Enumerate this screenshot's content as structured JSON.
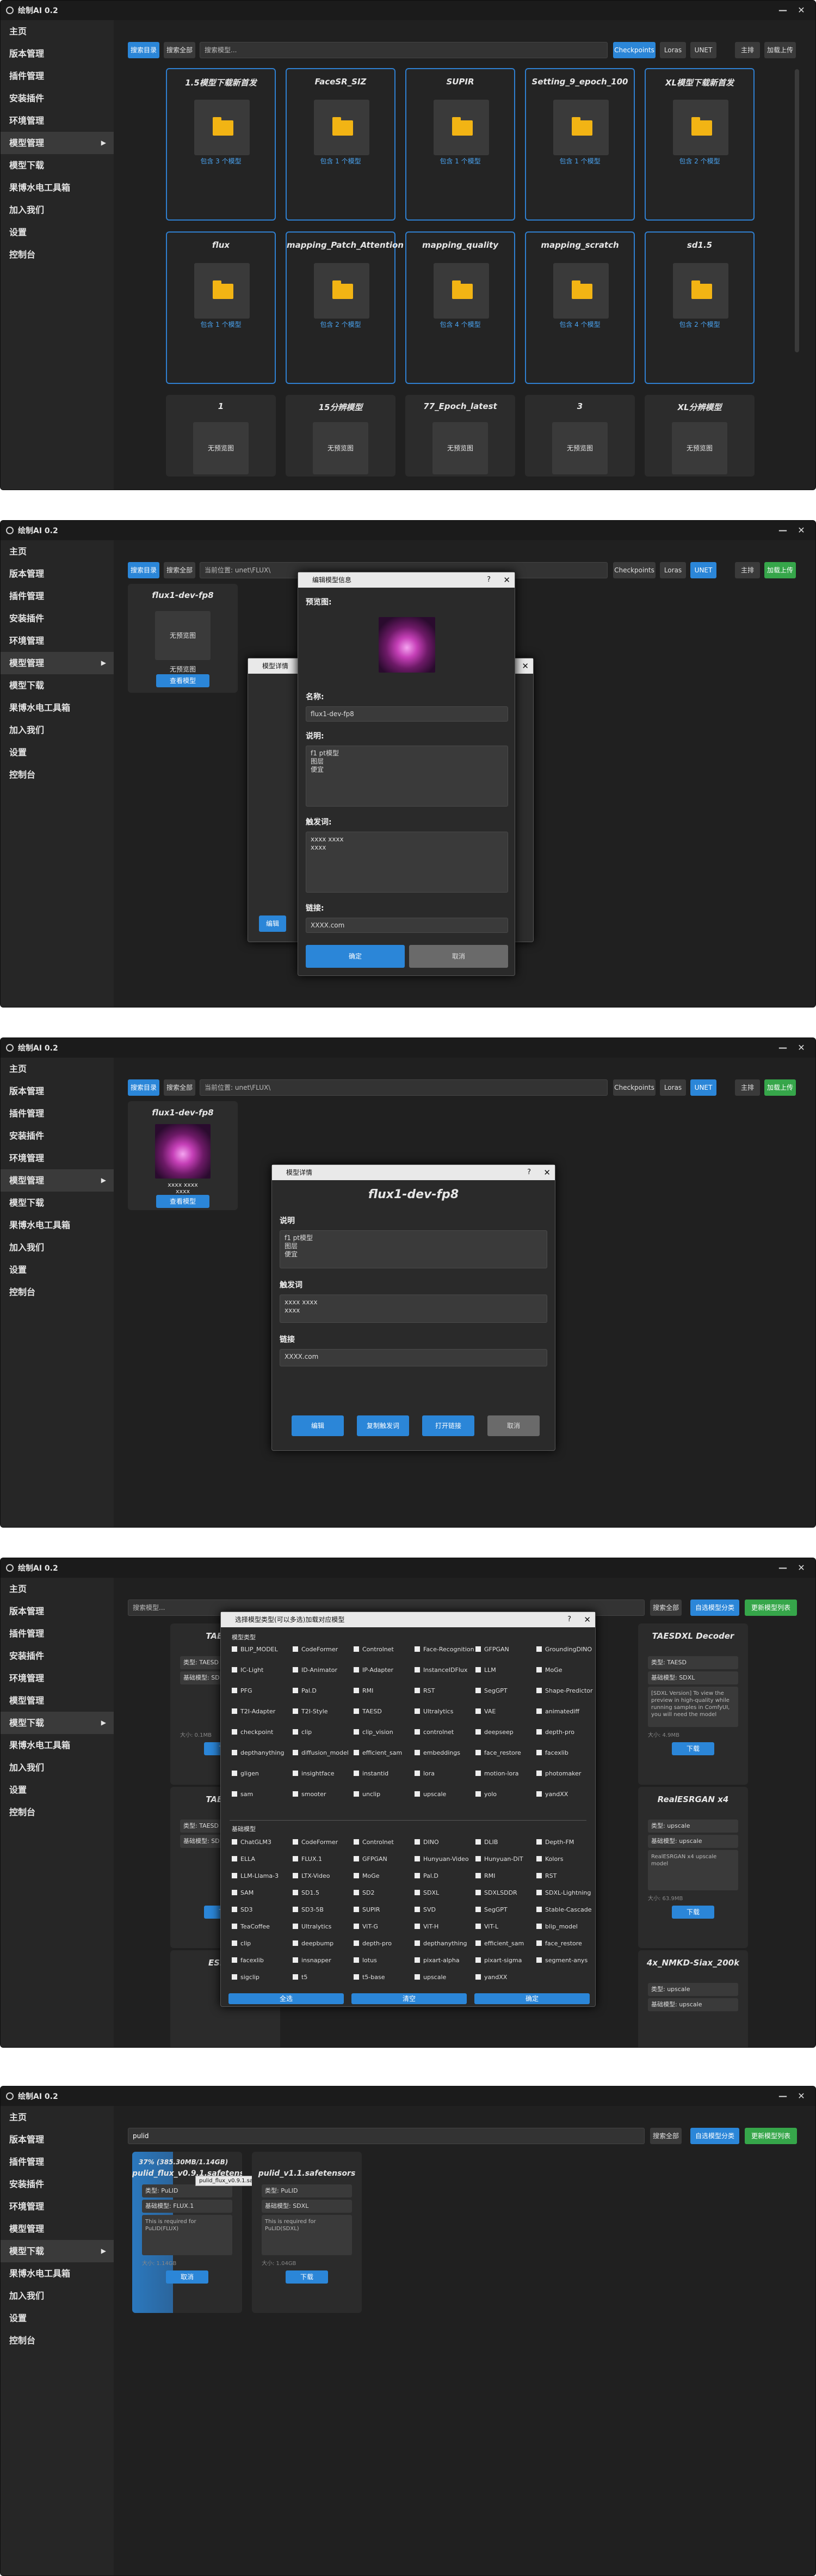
{
  "app": {
    "title": "绘制AI 0.2"
  },
  "sidebar": {
    "items": [
      "主页",
      "版本管理",
      "插件管理",
      "安装插件",
      "环境管理",
      "模型管理",
      "模型下载",
      "果博水电工具箱",
      "加入我们",
      "设置",
      "控制台"
    ]
  },
  "s1": {
    "toolbar": {
      "search_dir": "搜索目录",
      "search_all": "搜索全部",
      "search_placeholder": "搜索模型...",
      "checkpoints": "Checkpoints",
      "loras": "Loras",
      "unet": "UNET",
      "sort": "主排",
      "upload": "加载上传"
    },
    "folders": [
      {
        "name": "1.5模型下载新首发",
        "count": "包含 3 个模型"
      },
      {
        "name": "FaceSR_SIZ",
        "count": "包含 1 个模型"
      },
      {
        "name": "SUPIR",
        "count": "包含 1 个模型"
      },
      {
        "name": "Setting_9_epoch_100",
        "count": "包含 1 个模型"
      },
      {
        "name": "XL模型下载新首发",
        "count": "包含 2 个模型"
      },
      {
        "name": "flux",
        "count": "包含 1 个模型"
      },
      {
        "name": "mapping_Patch_Attention",
        "count": "包含 2 个模型"
      },
      {
        "name": "mapping_quality",
        "count": "包含 4 个模型"
      },
      {
        "name": "mapping_scratch",
        "count": "包含 4 个模型"
      },
      {
        "name": "sd1.5",
        "count": "包含 2 个模型"
      }
    ],
    "grid": [
      {
        "name": "1",
        "box": "无预览图"
      },
      {
        "name": "15分辨模型",
        "box": "无预览图"
      },
      {
        "name": "77_Epoch_latest",
        "box": "无预览图"
      },
      {
        "name": "3",
        "box": "无预览图"
      },
      {
        "name": "XL分辨模型",
        "box": "无预览图"
      }
    ]
  },
  "s2": {
    "toolbar": {
      "search_dir": "搜索目录",
      "search_all": "搜索全部",
      "search_placeholder": "当前位置: unet\\FLUX\\",
      "checkpoints": "Checkpoints",
      "loras": "Loras",
      "unet": "UNET",
      "sort": "主排",
      "upload": "加载上传"
    },
    "card": {
      "name": "flux1-dev-fp8",
      "box": "无预览图",
      "sub": "无预览图",
      "btn": "查看模型"
    },
    "dialog": {
      "title": "编辑模型信息",
      "preview_label": "预览图:",
      "name_label": "名称:",
      "name_value": "flux1-dev-fp8",
      "desc_label": "说明:",
      "desc_value": "f1 pt模型\n图层\n便宜",
      "trigger_label": "触发词:",
      "trigger_value": "xxxx xxxx\nxxxx",
      "url_label": "链接:",
      "url_value": "XXXX.com",
      "ok": "确定",
      "cancel": "取消"
    },
    "back_dialog": {
      "title": "模型详情",
      "btn": "编辑"
    }
  },
  "s3": {
    "toolbar": {
      "search_dir": "搜索目录",
      "search_all": "搜索全部",
      "search_placeholder": "当前位置: unet\\FLUX\\",
      "checkpoints": "Checkpoints",
      "loras": "Loras",
      "unet": "UNET",
      "sort": "主排",
      "upload": "加载上传"
    },
    "card": {
      "name": "flux1-dev-fp8",
      "trigger": "xxxx xxxx\nxxxx",
      "btn": "查看模型"
    },
    "dialog": {
      "title": "模型详情",
      "heading": "flux1-dev-fp8",
      "desc_label": "说明",
      "desc_value": "f1 pt模型\n图层\n便宜",
      "trigger_label": "触发词",
      "trigger_value": "xxxx xxxx\nxxxx",
      "url_label": "链接",
      "url_value": "XXXX.com",
      "b1": "编辑",
      "b2": "复制触发词",
      "b3": "打开链接",
      "b4": "取消"
    }
  },
  "s4": {
    "toolbar": {
      "search_placeholder": "搜索模型...",
      "search_all": "搜索全部",
      "btn1": "自选模型分类",
      "btn2": "更新模型列表"
    },
    "dialog": {
      "title": "选择模型类型(可以多选)加载对应模型",
      "section1": "模型类型",
      "section2": "基础模型",
      "ok": "全选",
      "clear": "清空",
      "confirm": "确定"
    },
    "types": [
      "BLIP_MODEL",
      "CodeFormer",
      "Controlnet",
      "Face-Recognition",
      "GFPGAN",
      "GroundingDINO",
      "IC-Light",
      "ID-Animator",
      "IP-Adapter",
      "InstanceIDFlux",
      "LLM",
      "MoGe",
      "PFG",
      "Pal.D",
      "RMI",
      "RST",
      "SegGPT",
      "Shape-Predictor",
      "T2I-Adapter",
      "T2I-Style",
      "TAESD",
      "Ultralytics",
      "VAE",
      "animatediff",
      "checkpoint",
      "clip",
      "clip_vision",
      "controlnet",
      "deepseep",
      "depth-pro",
      "depthanything",
      "diffusion_model",
      "efficient_sam",
      "embeddings",
      "face_restore",
      "facexlib",
      "gligen",
      "insightface",
      "instantid",
      "lora",
      "motion-lora",
      "photomaker",
      "sam",
      "smooter",
      "unclip",
      "upscale",
      "yolo",
      "yandXX"
    ],
    "bases": [
      "ChatGLM3",
      "CodeFormer",
      "Controlnet",
      "DINO",
      "DLIB",
      "Depth-FM",
      "ELLA",
      "FLUX.1",
      "GFPGAN",
      "Hunyuan-Video",
      "Hunyuan-DiT",
      "Kolors",
      "LLM-Llama-3",
      "LTX-Video",
      "MoGe",
      "Pal.D",
      "RMI",
      "RST",
      "SAM",
      "SD1.5",
      "SD2",
      "SDXL",
      "SDXLSDDR",
      "SDXL-Lightning",
      "SD3",
      "SD3-5B",
      "SUPIR",
      "SVD",
      "SegGPT",
      "Stable-Cascade",
      "TeaCoffee",
      "Ultralytics",
      "ViT-G",
      "ViT-H",
      "ViT-L",
      "blip_model",
      "clip",
      "deepbump",
      "depth-pro",
      "depthanything",
      "efficient_sam",
      "face_restore",
      "facexlib",
      "insnapper",
      "lotus",
      "pixart-alpha",
      "pixart-sigma",
      "segment-anys",
      "sigclip",
      "t5",
      "t5-base",
      "upscale",
      "yandXX"
    ],
    "cards": [
      {
        "name": "TAESD...",
        "type": "类型: TAESD",
        "base": "基础模型: SD",
        "desc": "",
        "size": "大小: 0.1MB",
        "btn": "下载"
      },
      {
        "name": "TAESD...",
        "type": "类型: TAESD",
        "base": "基础模型: SD",
        "desc": "",
        "size": "",
        "btn": "下载"
      },
      {
        "name": "ESRG...",
        "type": "",
        "base": "",
        "desc": "",
        "size": "",
        "btn": ""
      },
      {
        "name": "TAESDXL Decoder",
        "type": "类型: TAESD",
        "base": "基础模型: SDXL",
        "desc": "[SDXL Version] To view the preview in high-quality while running samples in ComfyUI, you will need the model",
        "size": "大小: 4.9MB",
        "btn": "下载"
      },
      {
        "name": "RealESRGAN x4",
        "type": "类型: upscale",
        "base": "基础模型: upscale",
        "desc": "RealESRGAN x4 upscale model",
        "size": "大小: 63.9MB",
        "btn": "下载"
      },
      {
        "name": "4x_NMKD-Siax_200k",
        "type": "类型: upscale",
        "base": "基础模型: upscale",
        "desc": "",
        "size": "",
        "btn": ""
      }
    ]
  },
  "s5": {
    "search_value": "pulid",
    "toolbar": {
      "search_all": "搜索全部",
      "btn1": "自选模型分类",
      "btn2": "更新模型列表"
    },
    "cards": [
      {
        "name": "pulid_flux_v0.9.1.safetensors",
        "progress_text": "37% (385.30MB/1.14GB)",
        "tooltip": "pulid_flux_v0.9.1.safetensors",
        "type": "类型: PuLID",
        "base": "基础模型: FLUX.1",
        "desc": "This is required for PuLID(FLUX)",
        "size": "大小: 1.14GB",
        "btn": "取消",
        "progress": 0.37
      },
      {
        "name": "pulid_v1.1.safetensors",
        "type": "类型: PuLID",
        "base": "基础模型: SDXL",
        "desc": "This is required for PuLID(SDXL)",
        "size": "大小: 1.04GB",
        "btn": "下载"
      }
    ]
  },
  "colors": {
    "accent": "#2b86d8",
    "green": "#36a64a",
    "folder": "#f2b414"
  }
}
